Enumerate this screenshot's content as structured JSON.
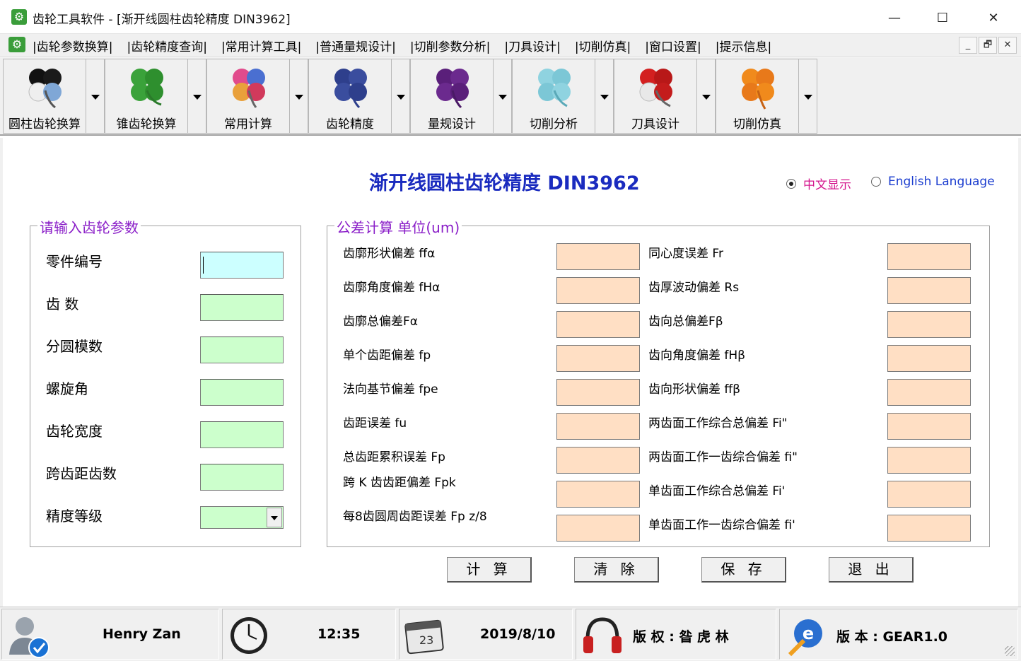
{
  "window": {
    "title": "齿轮工具软件 - [渐开线圆柱齿轮精度 DIN3962]",
    "minimize_glyph": "—",
    "maximize_glyph": "☐",
    "close_glyph": "✕",
    "icon": "gear-app-icon"
  },
  "menu": {
    "items": [
      "|齿轮参数换算|",
      "|齿轮精度查询|",
      "|常用计算工具|",
      "|普通量规设计|",
      "|切削参数分析|",
      "|刀具设计|",
      "|切削仿真|",
      "|窗口设置|",
      "|提示信息|"
    ],
    "mdi_minimize": "_",
    "mdi_restore": "🗗",
    "mdi_close": "✕"
  },
  "toolbar": {
    "buttons": [
      {
        "label": "圆柱齿轮换算",
        "icon": "clover-black-icon"
      },
      {
        "label": "锥齿轮换算",
        "icon": "clover-green-icon"
      },
      {
        "label": "常用计算",
        "icon": "clover-colorful-icon"
      },
      {
        "label": "齿轮精度",
        "icon": "clover-blue-icon"
      },
      {
        "label": "量规设计",
        "icon": "clover-purple-icon"
      },
      {
        "label": "切削分析",
        "icon": "clover-cyan-icon"
      },
      {
        "label": "刀具设计",
        "icon": "clover-red-icon"
      },
      {
        "label": "切削仿真",
        "icon": "clover-orange-icon"
      }
    ]
  },
  "main": {
    "title": "渐开线圆柱齿轮精度 DIN3962",
    "lang": {
      "chinese": "中文显示",
      "english": "English Language",
      "selected": "chinese"
    },
    "input_group": {
      "legend": "请输入齿轮参数",
      "fields": [
        {
          "label": "零件编号",
          "value": ""
        },
        {
          "label": "齿  数",
          "value": ""
        },
        {
          "label": "分圆模数",
          "value": ""
        },
        {
          "label": "螺旋角",
          "value": ""
        },
        {
          "label": "齿轮宽度",
          "value": ""
        },
        {
          "label": "跨齿距齿数",
          "value": ""
        },
        {
          "label": "精度等级",
          "value": ""
        }
      ]
    },
    "tolerance_group": {
      "legend": "公差计算 单位(um)",
      "left": [
        {
          "label": "齿廓形状偏差 ffα",
          "value": ""
        },
        {
          "label": "齿廓角度偏差 fHα",
          "value": ""
        },
        {
          "label": "齿廓总偏差Fα",
          "value": ""
        },
        {
          "label": "单个齿距偏差 fp",
          "value": ""
        },
        {
          "label": "法向基节偏差 fpe",
          "value": ""
        },
        {
          "label": "齿距误差 fu",
          "value": ""
        },
        {
          "label": "总齿距累积误差 Fp",
          "value": ""
        },
        {
          "label": "跨 K 齿齿距偏差 Fpk",
          "value": ""
        },
        {
          "label": "每8齿圆周齿距误差 Fp z/8",
          "value": ""
        }
      ],
      "right": [
        {
          "label": "同心度误差 Fr",
          "value": ""
        },
        {
          "label": "齿厚波动偏差 Rs",
          "value": ""
        },
        {
          "label": "齿向总偏差Fβ",
          "value": ""
        },
        {
          "label": "齿向角度偏差 fHβ",
          "value": ""
        },
        {
          "label": "齿向形状偏差 ffβ",
          "value": ""
        },
        {
          "label": "两齿面工作综合总偏差 Fi\"",
          "value": ""
        },
        {
          "label": "两齿面工作一齿综合偏差 fi\"",
          "value": ""
        },
        {
          "label": "单齿面工作综合总偏差 Fi'",
          "value": ""
        },
        {
          "label": "单齿面工作一齿综合偏差 fi'",
          "value": ""
        }
      ]
    },
    "actions": {
      "calc": "计 算",
      "clear": "清 除",
      "save": "保 存",
      "exit": "退 出"
    }
  },
  "status": {
    "user": "Henry Zan",
    "time": "12:35",
    "date": "2019/8/10",
    "calendar_day": "23",
    "copyright": "版 权 :  昝 虎 林",
    "version": "版 本 :  GEAR1.0"
  },
  "colors": {
    "title_blue": "#1a2bbf",
    "legend_purple": "#8a1ec8",
    "input_green": "#ccffcc",
    "input_active": "#ccffff",
    "output_peach": "#ffdfc4",
    "lang_chinese": "#d4148c",
    "lang_english": "#1a3ccf"
  }
}
